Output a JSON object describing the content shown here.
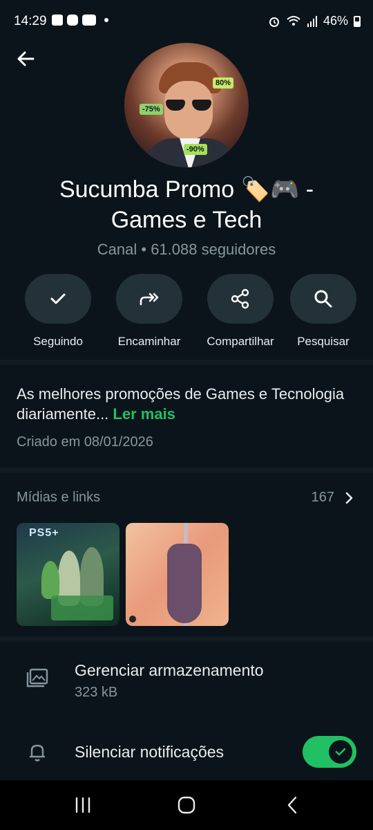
{
  "status_bar": {
    "time": "14:29",
    "battery": "46%"
  },
  "channel": {
    "name_line1": "Sucumba Promo 🏷️🎮  -",
    "name_line2": "Games e Tech",
    "subtitle": "Canal • 61.088 seguidores",
    "avatar_tags": [
      "80%",
      "-75%",
      "-90%"
    ]
  },
  "actions": [
    {
      "label": "Seguindo",
      "icon": "check-icon"
    },
    {
      "label": "Encaminhar",
      "icon": "forward-icon"
    },
    {
      "label": "Compartilhar",
      "icon": "share-icon"
    },
    {
      "label": "Pesquisar",
      "icon": "search-icon"
    }
  ],
  "description": {
    "text": "As melhores promoções de Games e Tecnologia diariamente...",
    "more_label": "Ler mais",
    "created": "Criado em 08/01/2026"
  },
  "media": {
    "title": "Mídias e links",
    "count": "167",
    "thumb1_text": "PS5+"
  },
  "rows": {
    "storage_title": "Gerenciar armazenamento",
    "storage_size": "323 kB",
    "mute_title": "Silenciar notificações",
    "mute_enabled": true
  },
  "colors": {
    "accent": "#21c063",
    "background": "#0b141a",
    "muted_text": "#8696a0"
  }
}
